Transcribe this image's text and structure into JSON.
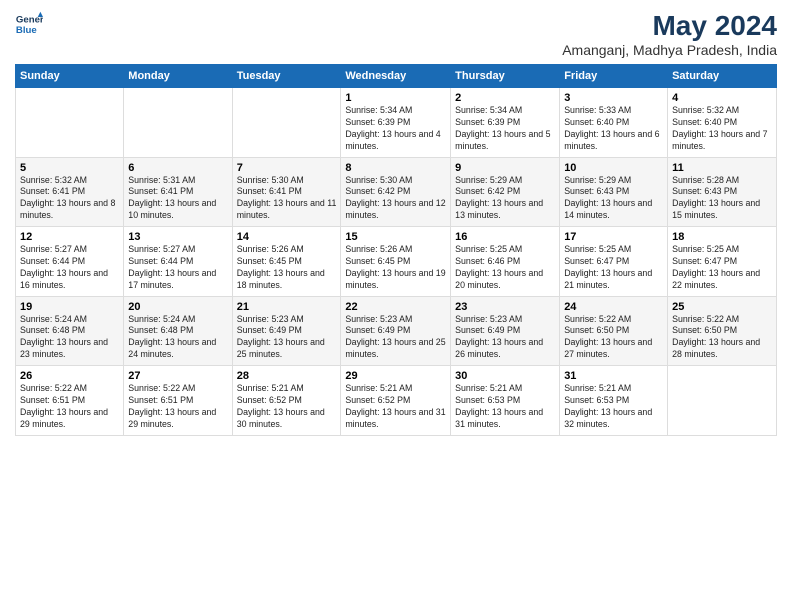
{
  "header": {
    "logo_line1": "General",
    "logo_line2": "Blue",
    "title": "May 2024",
    "subtitle": "Amanganj, Madhya Pradesh, India"
  },
  "days_of_week": [
    "Sunday",
    "Monday",
    "Tuesday",
    "Wednesday",
    "Thursday",
    "Friday",
    "Saturday"
  ],
  "weeks": [
    [
      {
        "day": "",
        "info": ""
      },
      {
        "day": "",
        "info": ""
      },
      {
        "day": "",
        "info": ""
      },
      {
        "day": "1",
        "info": "Sunrise: 5:34 AM\nSunset: 6:39 PM\nDaylight: 13 hours and 4 minutes."
      },
      {
        "day": "2",
        "info": "Sunrise: 5:34 AM\nSunset: 6:39 PM\nDaylight: 13 hours and 5 minutes."
      },
      {
        "day": "3",
        "info": "Sunrise: 5:33 AM\nSunset: 6:40 PM\nDaylight: 13 hours and 6 minutes."
      },
      {
        "day": "4",
        "info": "Sunrise: 5:32 AM\nSunset: 6:40 PM\nDaylight: 13 hours and 7 minutes."
      }
    ],
    [
      {
        "day": "5",
        "info": "Sunrise: 5:32 AM\nSunset: 6:41 PM\nDaylight: 13 hours and 8 minutes."
      },
      {
        "day": "6",
        "info": "Sunrise: 5:31 AM\nSunset: 6:41 PM\nDaylight: 13 hours and 10 minutes."
      },
      {
        "day": "7",
        "info": "Sunrise: 5:30 AM\nSunset: 6:41 PM\nDaylight: 13 hours and 11 minutes."
      },
      {
        "day": "8",
        "info": "Sunrise: 5:30 AM\nSunset: 6:42 PM\nDaylight: 13 hours and 12 minutes."
      },
      {
        "day": "9",
        "info": "Sunrise: 5:29 AM\nSunset: 6:42 PM\nDaylight: 13 hours and 13 minutes."
      },
      {
        "day": "10",
        "info": "Sunrise: 5:29 AM\nSunset: 6:43 PM\nDaylight: 13 hours and 14 minutes."
      },
      {
        "day": "11",
        "info": "Sunrise: 5:28 AM\nSunset: 6:43 PM\nDaylight: 13 hours and 15 minutes."
      }
    ],
    [
      {
        "day": "12",
        "info": "Sunrise: 5:27 AM\nSunset: 6:44 PM\nDaylight: 13 hours and 16 minutes."
      },
      {
        "day": "13",
        "info": "Sunrise: 5:27 AM\nSunset: 6:44 PM\nDaylight: 13 hours and 17 minutes."
      },
      {
        "day": "14",
        "info": "Sunrise: 5:26 AM\nSunset: 6:45 PM\nDaylight: 13 hours and 18 minutes."
      },
      {
        "day": "15",
        "info": "Sunrise: 5:26 AM\nSunset: 6:45 PM\nDaylight: 13 hours and 19 minutes."
      },
      {
        "day": "16",
        "info": "Sunrise: 5:25 AM\nSunset: 6:46 PM\nDaylight: 13 hours and 20 minutes."
      },
      {
        "day": "17",
        "info": "Sunrise: 5:25 AM\nSunset: 6:47 PM\nDaylight: 13 hours and 21 minutes."
      },
      {
        "day": "18",
        "info": "Sunrise: 5:25 AM\nSunset: 6:47 PM\nDaylight: 13 hours and 22 minutes."
      }
    ],
    [
      {
        "day": "19",
        "info": "Sunrise: 5:24 AM\nSunset: 6:48 PM\nDaylight: 13 hours and 23 minutes."
      },
      {
        "day": "20",
        "info": "Sunrise: 5:24 AM\nSunset: 6:48 PM\nDaylight: 13 hours and 24 minutes."
      },
      {
        "day": "21",
        "info": "Sunrise: 5:23 AM\nSunset: 6:49 PM\nDaylight: 13 hours and 25 minutes."
      },
      {
        "day": "22",
        "info": "Sunrise: 5:23 AM\nSunset: 6:49 PM\nDaylight: 13 hours and 25 minutes."
      },
      {
        "day": "23",
        "info": "Sunrise: 5:23 AM\nSunset: 6:49 PM\nDaylight: 13 hours and 26 minutes."
      },
      {
        "day": "24",
        "info": "Sunrise: 5:22 AM\nSunset: 6:50 PM\nDaylight: 13 hours and 27 minutes."
      },
      {
        "day": "25",
        "info": "Sunrise: 5:22 AM\nSunset: 6:50 PM\nDaylight: 13 hours and 28 minutes."
      }
    ],
    [
      {
        "day": "26",
        "info": "Sunrise: 5:22 AM\nSunset: 6:51 PM\nDaylight: 13 hours and 29 minutes."
      },
      {
        "day": "27",
        "info": "Sunrise: 5:22 AM\nSunset: 6:51 PM\nDaylight: 13 hours and 29 minutes."
      },
      {
        "day": "28",
        "info": "Sunrise: 5:21 AM\nSunset: 6:52 PM\nDaylight: 13 hours and 30 minutes."
      },
      {
        "day": "29",
        "info": "Sunrise: 5:21 AM\nSunset: 6:52 PM\nDaylight: 13 hours and 31 minutes."
      },
      {
        "day": "30",
        "info": "Sunrise: 5:21 AM\nSunset: 6:53 PM\nDaylight: 13 hours and 31 minutes."
      },
      {
        "day": "31",
        "info": "Sunrise: 5:21 AM\nSunset: 6:53 PM\nDaylight: 13 hours and 32 minutes."
      },
      {
        "day": "",
        "info": ""
      }
    ]
  ]
}
